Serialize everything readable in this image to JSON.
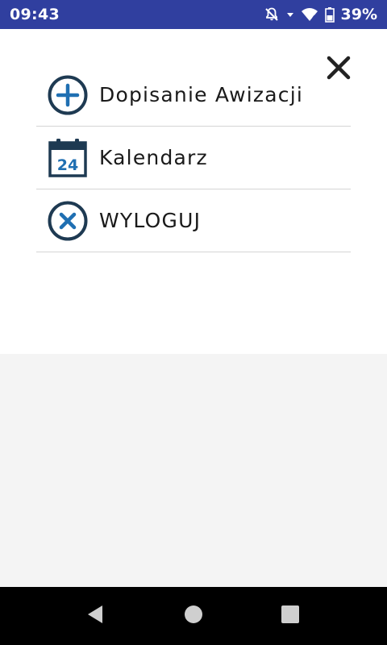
{
  "status_bar": {
    "time": "09:43",
    "battery": "39%",
    "icons": [
      "bell-off-icon",
      "wifi-icon",
      "signal-icon",
      "battery-icon"
    ],
    "color": "#303f9f"
  },
  "menu": {
    "close_icon": "close-icon",
    "items": [
      {
        "label": "Dopisanie Awizacji",
        "icon": "plus-circle-icon"
      },
      {
        "label": "Kalendarz",
        "icon": "calendar-icon",
        "icon_text": "24"
      },
      {
        "label": "WYLOGUJ",
        "icon": "x-circle-icon"
      }
    ],
    "accent_color": "#1f6fb2",
    "icon_outline_color": "#1e3a52"
  },
  "nav_bar": {
    "buttons": [
      "back-icon",
      "home-icon",
      "recents-icon"
    ]
  }
}
